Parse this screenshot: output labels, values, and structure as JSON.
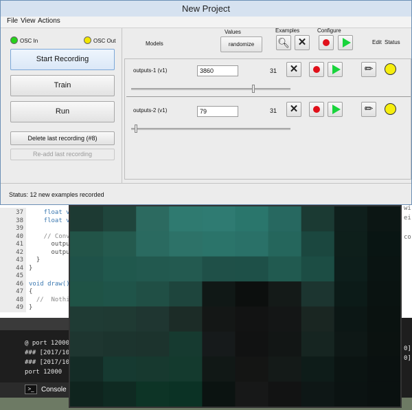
{
  "window": {
    "title": "New Project"
  },
  "menu": [
    "File",
    "View",
    "Actions"
  ],
  "osc": {
    "in_label": "OSC In",
    "out_label": "OSC Out",
    "in_color": "#26d11b",
    "out_color": "#f2e600"
  },
  "controls": {
    "start_recording": "Start Recording",
    "train": "Train",
    "run": "Run",
    "delete_last": "Delete last recording (#8)",
    "readd_last": "Re-add last recording"
  },
  "headers": {
    "models": "Models",
    "values": "Values",
    "randomize": "randomize",
    "examples": "Examples",
    "configure": "Configure",
    "edit": "Edit",
    "status": "Status"
  },
  "models": [
    {
      "name": "outputs-1 (v1)",
      "value": "3860",
      "examples": "31",
      "slider_fraction": 0.77
    },
    {
      "name": "outputs-2 (v1)",
      "value": "79",
      "examples": "31",
      "slider_fraction": 0.02
    }
  ],
  "status_bar": {
    "text": "Status:  12 new examples recorded"
  },
  "editor": {
    "lines": [
      {
        "num": "37",
        "text": "    float va"
      },
      {
        "num": "38",
        "text": "    float va"
      },
      {
        "num": "39",
        "text": ""
      },
      {
        "num": "40",
        "text": "    // Conve"
      },
      {
        "num": "41",
        "text": "      output"
      },
      {
        "num": "42",
        "text": "      output"
      },
      {
        "num": "43",
        "text": "  }"
      },
      {
        "num": "44",
        "text": "}"
      },
      {
        "num": "45",
        "text": ""
      },
      {
        "num": "46",
        "text": "void draw()"
      },
      {
        "num": "47",
        "text": "{"
      },
      {
        "num": "48",
        "text": "  //  Nothin"
      },
      {
        "num": "49",
        "text": "}"
      }
    ],
    "right_fragments": [
      "wi",
      "ei",
      "",
      "co"
    ]
  },
  "console": {
    "lines": [
      "@ port 12000",
      "### [2017/10",
      "### [2017/10",
      "port 12000"
    ],
    "right_fragments": [
      "0]",
      "0]"
    ],
    "tab_label": "Console"
  },
  "sketch_grid": [
    [
      "#1d3a33",
      "#1f453c",
      "#2c6a60",
      "#2f7a70",
      "#2f7b72",
      "#2a766c",
      "#276860",
      "#1b3a33",
      "#0f1f1c",
      "#0c1614"
    ],
    [
      "#225448",
      "#245a4e",
      "#2a6a60",
      "#2d7268",
      "#2b746a",
      "#2a7168",
      "#25665c",
      "#1b473f",
      "#0e1f1b",
      "#091513"
    ],
    [
      "#1f5249",
      "#20584d",
      "#22594f",
      "#235a50",
      "#1f5048",
      "#1e5048",
      "#215a50",
      "#1c4d44",
      "#0d1e1b",
      "#0a1412"
    ],
    [
      "#1f5346",
      "#1f5449",
      "#204f45",
      "#1e453d",
      "#101816",
      "#0c0f0e",
      "#141a18",
      "#1c3530",
      "#0c1b18",
      "#0a1311"
    ],
    [
      "#1f3b34",
      "#1f3a33",
      "#1f3631",
      "#1c2c27",
      "#141716",
      "#121313",
      "#141616",
      "#1a2622",
      "#0c1715",
      "#0a1210"
    ],
    [
      "#1e3630",
      "#1c342e",
      "#1c332d",
      "#163a30",
      "#161a1b",
      "#111212",
      "#121615",
      "#162521",
      "#0e1816",
      "#0b1210"
    ],
    [
      "#142c26",
      "#163a31",
      "#17392f",
      "#143a2e",
      "#111816",
      "#141514",
      "#141a18",
      "#0e1c19",
      "#0b1412",
      "#0a1110"
    ],
    [
      "#0f241e",
      "#0f2a22",
      "#0d3426",
      "#0b3225",
      "#0b1311",
      "#171818",
      "#121313",
      "#0e1716",
      "#0b1312",
      "#0a1110"
    ]
  ],
  "colors": {
    "record": "#e0101a",
    "play": "#19d43c",
    "status_light": "#f6ee0f"
  }
}
